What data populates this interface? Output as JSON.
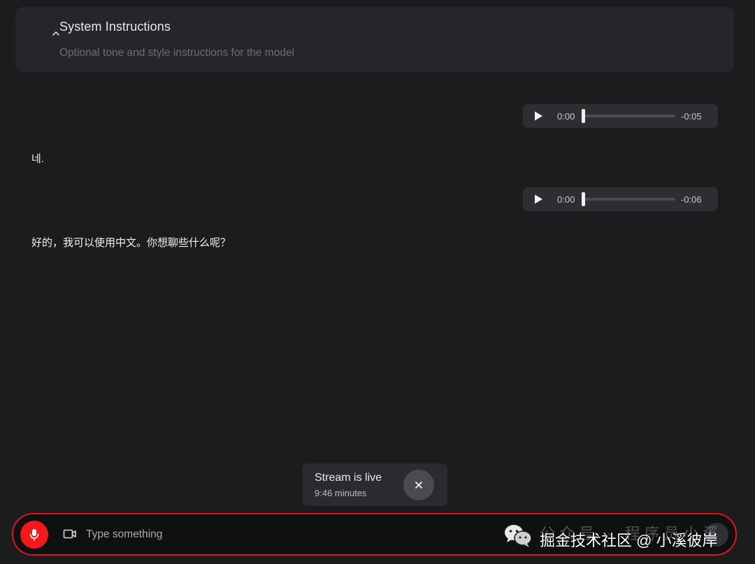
{
  "system_instructions": {
    "title": "System Instructions",
    "placeholder": "Optional tone and style instructions for the model"
  },
  "messages": [
    {
      "type": "audio",
      "current_time": "0:00",
      "remaining": "-0:05",
      "progress": 0
    },
    {
      "type": "text",
      "text": "네."
    },
    {
      "type": "audio",
      "current_time": "0:00",
      "remaining": "-0:06",
      "progress": 0
    },
    {
      "type": "text",
      "text": "好的，我可以使用中文。你想聊些什么呢？"
    }
  ],
  "stream": {
    "title": "Stream is live",
    "duration": "9:46 minutes"
  },
  "composer": {
    "placeholder": "Type something",
    "value": ""
  },
  "watermark": {
    "faint_text": "公众号 · 程序员小溪",
    "text": "掘金技术社区 @ 小溪彼岸"
  },
  "icons": {
    "collapse": "chevron-up-icon",
    "play": "play-icon",
    "close": "close-icon",
    "mic": "mic-icon",
    "camera": "video-camera-icon",
    "wechat": "wechat-icon"
  },
  "colors": {
    "background": "#1b1c1e",
    "panel": "#252629",
    "mic_accent": "#f2181c",
    "highlight_border": "#e0141b"
  }
}
